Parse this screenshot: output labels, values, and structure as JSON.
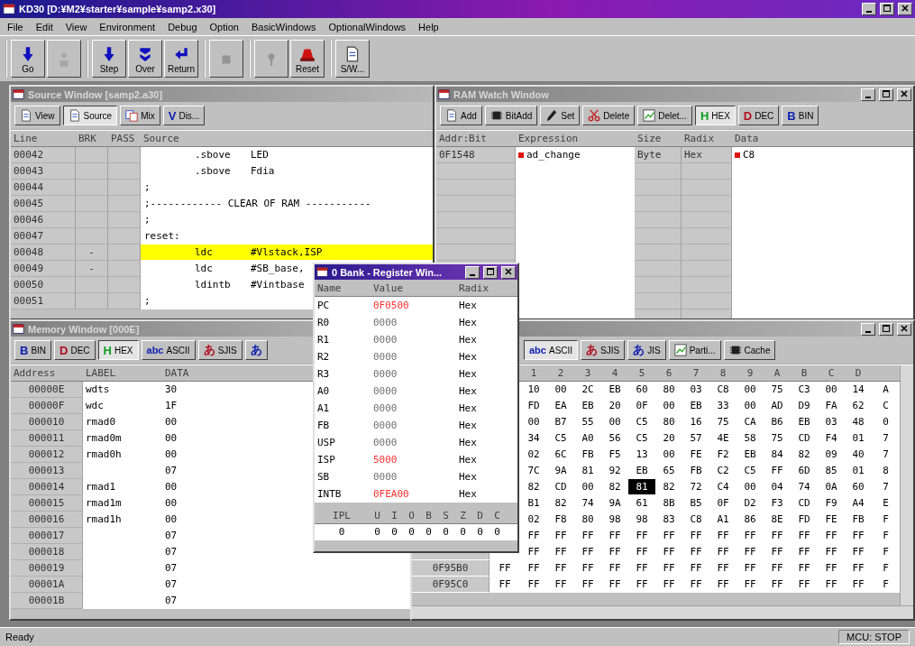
{
  "window": {
    "title": "KD30 [D:¥M2¥starter¥sample¥samp2.x30]"
  },
  "menu": [
    "File",
    "Edit",
    "View",
    "Environment",
    "Debug",
    "Option",
    "BasicWindows",
    "OptionalWindows",
    "Help"
  ],
  "toolbar": [
    [
      {
        "label": "Go",
        "kind": "down",
        "disabled": false
      },
      {
        "kind": "figure",
        "disabled": true
      }
    ],
    [
      {
        "label": "Step",
        "kind": "down",
        "disabled": false
      },
      {
        "label": "Over",
        "kind": "over",
        "disabled": false
      },
      {
        "label": "Return",
        "kind": "return",
        "disabled": false
      }
    ],
    [
      {
        "kind": "square",
        "disabled": true
      }
    ],
    [
      {
        "kind": "pin",
        "disabled": true
      },
      {
        "label": "Reset",
        "kind": "reset",
        "disabled": false
      }
    ],
    [
      {
        "label": "S/W...",
        "kind": "doc",
        "disabled": false
      }
    ]
  ],
  "windows": [
    {
      "kind": "source",
      "title": "Source Window [samp2.a30]",
      "active": false,
      "controls": false,
      "tabs": [
        {
          "label": "View",
          "kind": "doc",
          "selected": false
        },
        {
          "label": "Source",
          "kind": "doc",
          "selected": true
        },
        {
          "label": "Mix",
          "kind": "mix",
          "selected": false
        },
        {
          "label": "Dis...",
          "glyph": "V",
          "kind": "dis",
          "selected": false
        }
      ],
      "columns": [
        "Line",
        "BRK",
        "PASS",
        "Source"
      ],
      "rows": [
        {
          "line": "00042",
          "op": ".sbove",
          "args": "LED",
          "current": false
        },
        {
          "line": "00043",
          "op": ".sbove",
          "args": "Fdia",
          "current": false
        },
        {
          "line": "00044",
          "comment": ";",
          "current": false
        },
        {
          "line": "00045",
          "comment": ";------------ CLEAR OF RAM -----------",
          "current": false
        },
        {
          "line": "00046",
          "comment": ";",
          "current": false
        },
        {
          "line": "00047",
          "label": "reset:",
          "current": false
        },
        {
          "line": "00048",
          "brk": "-",
          "op": "ldc",
          "args": "#Vlstack,ISP",
          "current": true
        },
        {
          "line": "00049",
          "brk": "-",
          "op": "ldc",
          "args": "#SB_base,",
          "current": false
        },
        {
          "line": "00050",
          "op": "ldintb",
          "args": "#Vintbase",
          "current": false
        },
        {
          "line": "00051",
          "comment": ";",
          "current": false
        }
      ]
    },
    {
      "kind": "watch",
      "title": "RAM Watch Window",
      "active": false,
      "controls": true,
      "tabs": [
        {
          "label": "Add",
          "kind": "doc",
          "selected": false
        },
        {
          "label": "BitAdd",
          "kind": "chip",
          "selected": false
        },
        {
          "label": "Set",
          "kind": "pen",
          "selected": false
        },
        {
          "label": "Delete",
          "kind": "scissors",
          "selected": false
        },
        {
          "label": "Delet...",
          "kind": "chart",
          "selected": false
        },
        {
          "label": "HEX",
          "glyph": "H",
          "kind": "hex",
          "selected": true
        },
        {
          "label": "DEC",
          "glyph": "D",
          "kind": "dec",
          "selected": false
        },
        {
          "label": "BIN",
          "glyph": "B",
          "kind": "bin",
          "selected": false
        }
      ],
      "columns": [
        "Addr:Bit",
        "Expression",
        "Size",
        "Radix",
        "Data"
      ],
      "rows": [
        {
          "address": "0F1548",
          "expression": "ad_change",
          "size": "Byte",
          "radix": "Hex",
          "data": "C8",
          "marked": true
        }
      ]
    },
    {
      "kind": "memory",
      "title": "Memory Window [000E]",
      "active": false,
      "controls": false,
      "tabs": [
        {
          "label": "BIN",
          "glyph": "B",
          "kind": "bin",
          "selected": false
        },
        {
          "label": "DEC",
          "glyph": "D",
          "kind": "dec",
          "selected": false
        },
        {
          "label": "HEX",
          "glyph": "H",
          "kind": "hex",
          "selected": true
        },
        {
          "label": "ASCII",
          "glyph": "abc",
          "kind": "ascii",
          "selected": false
        },
        {
          "label": "SJIS",
          "glyph": "あ",
          "kind": "sjis",
          "selected": false
        },
        {
          "glyph": "あ",
          "kind": "jis",
          "selected": false
        }
      ],
      "columns": [
        "Address",
        "LABEL",
        "DATA"
      ],
      "rows": [
        {
          "address": "00000E",
          "label": "wdts",
          "data": "30"
        },
        {
          "address": "00000F",
          "label": "wdc",
          "data": "1F"
        },
        {
          "address": "000010",
          "label": "rmad0",
          "data": "00"
        },
        {
          "address": "000011",
          "label": "rmad0m",
          "data": "00"
        },
        {
          "address": "000012",
          "label": "rmad0h",
          "data": "00"
        },
        {
          "address": "000013",
          "data": "07"
        },
        {
          "address": "000014",
          "label": "rmad1",
          "data": "00"
        },
        {
          "address": "000015",
          "label": "rmad1m",
          "data": "00"
        },
        {
          "address": "000016",
          "label": "rmad1h",
          "data": "00"
        },
        {
          "address": "000017",
          "data": "07"
        },
        {
          "address": "000018",
          "data": "07"
        },
        {
          "address": "000019",
          "data": "07"
        },
        {
          "address": "00001A",
          "data": "07"
        },
        {
          "address": "00001B",
          "data": "07"
        }
      ]
    },
    {
      "kind": "dump",
      "active": false,
      "controls": true,
      "tabs": [
        {
          "label": "ASCII",
          "glyph": "abc",
          "kind": "ascii",
          "selected": true
        },
        {
          "label": "SJIS",
          "glyph": "あ",
          "kind": "sjis",
          "selected": false
        },
        {
          "label": "JIS",
          "glyph": "あ",
          "kind": "jis",
          "selected": false
        },
        {
          "label": "Parti...",
          "kind": "chart",
          "selected": false
        },
        {
          "label": "Cache",
          "kind": "chip",
          "selected": false
        }
      ],
      "columns": [
        "1",
        "2",
        "3",
        "4",
        "5",
        "6",
        "7",
        "8",
        "9",
        "A",
        "B",
        "C",
        "D"
      ],
      "rows": [
        {
          "cells": [
            "10",
            "00",
            "2C",
            "EB",
            "60",
            "80",
            "03",
            "C8",
            "00",
            "75",
            "C3",
            "00",
            "14",
            "A"
          ]
        },
        {
          "cells": [
            "FD",
            "EA",
            "EB",
            "20",
            "0F",
            "00",
            "EB",
            "33",
            "00",
            "AD",
            "D9",
            "FA",
            "62",
            "C"
          ]
        },
        {
          "cells": [
            "00",
            "B7",
            "55",
            "00",
            "C5",
            "80",
            "16",
            "75",
            "CA",
            "B6",
            "EB",
            "03",
            "48",
            "0"
          ]
        },
        {
          "cells": [
            "34",
            "C5",
            "A0",
            "56",
            "C5",
            "20",
            "57",
            "4E",
            "58",
            "75",
            "CD",
            "F4",
            "01",
            "7"
          ]
        },
        {
          "cells": [
            "02",
            "6C",
            "FB",
            "F5",
            "13",
            "00",
            "FE",
            "F2",
            "EB",
            "84",
            "82",
            "09",
            "40",
            "7"
          ]
        },
        {
          "cells": [
            "7C",
            "9A",
            "81",
            "92",
            "EB",
            "65",
            "FB",
            "C2",
            "C5",
            "FF",
            "6D",
            "85",
            "01",
            "8"
          ]
        },
        {
          "cells": [
            "82",
            "CD",
            "00",
            "82",
            {
              "value": "81",
              "selected": true
            },
            "82",
            "72",
            "C4",
            "00",
            "04",
            "74",
            "0A",
            "60",
            "7"
          ]
        },
        {
          "cells": [
            "B1",
            "82",
            "74",
            "9A",
            "61",
            "8B",
            "B5",
            "0F",
            "D2",
            "F3",
            "CD",
            "F9",
            "A4",
            "E"
          ]
        },
        {
          "cells": [
            "02",
            "F8",
            "80",
            "98",
            "98",
            "83",
            "C8",
            "A1",
            "86",
            "8E",
            "FD",
            "FE",
            "FB",
            "F"
          ]
        },
        {
          "cells": [
            "FF",
            "FF",
            "FF",
            "FF",
            "FF",
            "FF",
            "FF",
            "FF",
            "FF",
            "FF",
            "FF",
            "FF",
            "FF",
            "F"
          ]
        },
        {
          "cells": [
            "FF",
            "FF",
            "FF",
            "FF",
            "FF",
            "FF",
            "FF",
            "FF",
            "FF",
            "FF",
            "FF",
            "FF",
            "FF",
            "F"
          ]
        },
        {
          "address": "0F95B0",
          "cells": [
            "FF",
            "FF",
            "FF",
            "FF",
            "FF",
            "FF",
            "FF",
            "FF",
            "FF",
            "FF",
            "FF",
            "FF",
            "FF",
            "FF",
            "F"
          ]
        },
        {
          "address": "0F95C0",
          "cells": [
            "FF",
            "FF",
            "FF",
            "FF",
            "FF",
            "FF",
            "FF",
            "FF",
            "FF",
            "FF",
            "FF",
            "FF",
            "FF",
            "FF",
            "F"
          ]
        }
      ]
    },
    {
      "kind": "register",
      "title": "0 Bank - Register Win...",
      "active": true,
      "controls": true,
      "columns": [
        "Name",
        "Value",
        "Radix"
      ],
      "rows": [
        {
          "name": "PC",
          "value": "0F0500",
          "radix": "Hex",
          "changed": true
        },
        {
          "name": "R0",
          "value": "0000",
          "radix": "Hex",
          "changed": false
        },
        {
          "name": "R1",
          "value": "0000",
          "radix": "Hex",
          "changed": false
        },
        {
          "name": "R2",
          "value": "0000",
          "radix": "Hex",
          "changed": false
        },
        {
          "name": "R3",
          "value": "0000",
          "radix": "Hex",
          "changed": false
        },
        {
          "name": "A0",
          "value": "0000",
          "radix": "Hex",
          "changed": false
        },
        {
          "name": "A1",
          "value": "0000",
          "radix": "Hex",
          "changed": false
        },
        {
          "name": "FB",
          "value": "0000",
          "radix": "Hex",
          "changed": false
        },
        {
          "name": "USP",
          "value": "0000",
          "radix": "Hex",
          "changed": false
        },
        {
          "name": "ISP",
          "value": "5000",
          "radix": "Hex",
          "changed": true
        },
        {
          "name": "SB",
          "value": "0000",
          "radix": "Hex",
          "changed": false
        },
        {
          "name": "INTB",
          "value": "0FEA00",
          "radix": "Hex",
          "changed": true
        }
      ],
      "flags": {
        "labels": [
          "IPL",
          "U",
          "I",
          "O",
          "B",
          "S",
          "Z",
          "D",
          "C"
        ],
        "values": [
          "0",
          "0",
          "0",
          "0",
          "0",
          "0",
          "0",
          "0",
          "0"
        ]
      }
    }
  ],
  "status_bar": {
    "message": "Ready",
    "mode": "MCU: STOP"
  }
}
